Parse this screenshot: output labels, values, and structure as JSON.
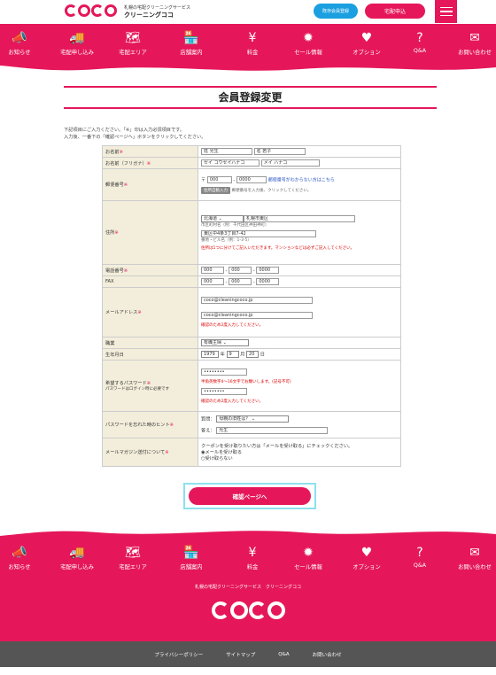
{
  "brand": {
    "sub1": "札幌の宅配クリーニングサービス",
    "name": "クリーニングココ",
    "logo_text": "coco"
  },
  "header": {
    "member_login": "既存会員登録",
    "order": "宅配申込"
  },
  "nav": [
    {
      "label": "お知らせ",
      "icon": "megaphone-icon",
      "glyph": "📣"
    },
    {
      "label": "宅配申し込み",
      "icon": "truck-icon",
      "glyph": "🚚"
    },
    {
      "label": "宅配エリア",
      "icon": "map-icon",
      "glyph": "🗺"
    },
    {
      "label": "店舗案内",
      "icon": "store-icon",
      "glyph": "🏪"
    },
    {
      "label": "料金",
      "icon": "money-bag-icon",
      "glyph": "¥"
    },
    {
      "label": "セール情報",
      "icon": "sale-badge-icon",
      "glyph": "✹"
    },
    {
      "label": "オプション",
      "icon": "heart-icon",
      "glyph": "♥"
    },
    {
      "label": "Q&A",
      "icon": "question-icon",
      "glyph": "?"
    },
    {
      "label": "お問い合わせ",
      "icon": "mail-icon",
      "glyph": "✉"
    }
  ],
  "page": {
    "title": "会員登録変更",
    "intro1": "下記項目にご入力ください。「※」印は入力必須項目です。",
    "intro2": "入力後、一番下の「確認ページへ」ボタンをクリックしてください。"
  },
  "form": {
    "name": {
      "label": "お名前",
      "last": "姓 光生",
      "first": "名 若子"
    },
    "kana": {
      "label": "お名前（フリガナ）",
      "last": "セイ コウセイハナコ",
      "first": "メイ ハナコ"
    },
    "postal": {
      "label": "郵便番号",
      "mark": "〒",
      "p1": "000",
      "dash": "-",
      "p2": "0000",
      "link": "郵便番号がわからない方はこちら",
      "btn": "住所自動入力",
      "hint": "郵便番号を入力後、クリックしてください。"
    },
    "address": {
      "label": "住所",
      "pref": "北海道",
      "city": "札幌市東区",
      "city_hint": "市区町村名（例：千代田区神田神町）",
      "street": "東区中4条3丁目7-42",
      "street_hint": "番地・ビル名（例：1-3-5）",
      "note": "住所は1つに分けてご記入いただきます。マンションなどは必ずご記入してください。"
    },
    "phone": {
      "label": "電話番号",
      "a": "000",
      "b": "000",
      "c": "0000",
      "dash": "-"
    },
    "fax": {
      "label": "FAX",
      "a": "000",
      "b": "000",
      "c": "0000",
      "dash": "-"
    },
    "email": {
      "label": "メールアドレス",
      "value": "coco@cleaningcoco.jp",
      "confirm": "coco@cleaningcoco.jp",
      "note": "確認のため2度入力してください。"
    },
    "job": {
      "label": "職業",
      "value": "有職主婦"
    },
    "birth": {
      "label": "生年月日",
      "year": "1979",
      "y": "年",
      "month": "9",
      "m": "月",
      "day": "20",
      "d": "日"
    },
    "password": {
      "label": "希望するパスワード",
      "sub": "パスワードはログイン時に必要です",
      "value": "••••••••",
      "note1": "半角英数字4～16文字でお願いします。(記号不可)",
      "confirm": "••••••••",
      "note2": "確認のため2度入力してください。"
    },
    "hint": {
      "label": "パスワードを忘れた時のヒント",
      "q_label": "質問：",
      "q": "母親の旧姓は？",
      "a_label": "答え：",
      "a": "光生"
    },
    "magazine": {
      "label": "メールマガジン送付について",
      "desc": "クーポンを受け取りたい方は「メールを受け取る」にチェックください。",
      "opt1": "メールを受け取る",
      "opt2": "受け取らない"
    },
    "required": "※"
  },
  "confirm_button": "確認ページへ",
  "footer": {
    "sub": "札幌の宅配クリーニングサービス　クリーニングココ",
    "links": [
      "プライバシーポリシー",
      "サイトマップ",
      "Q&A",
      "お問い合わせ"
    ]
  },
  "colors": {
    "brand": "#e5175a",
    "accent_blue": "#1a9fe0",
    "label_bg": "#f3eedb"
  }
}
